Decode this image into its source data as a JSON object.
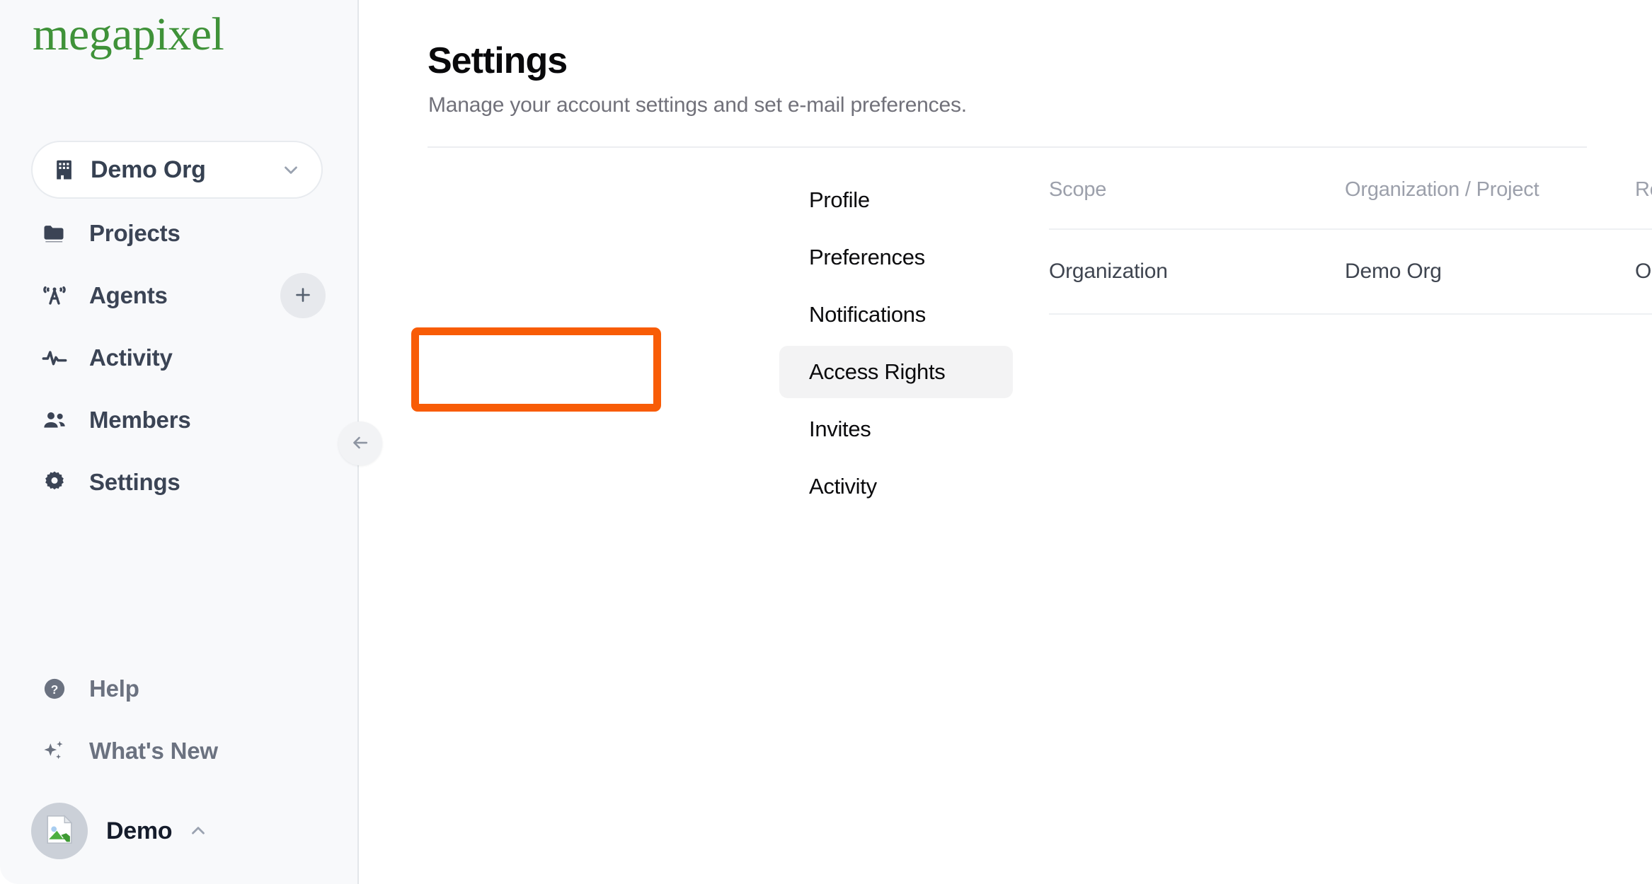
{
  "brand": {
    "logo_text": "megapixel",
    "logo_color": "#3f9239"
  },
  "sidebar": {
    "org_switcher": {
      "label": "Demo Org",
      "icon": "building-icon",
      "chevron": "chevron-down-icon"
    },
    "nav": [
      {
        "id": "projects",
        "label": "Projects",
        "icon": "folder-icon"
      },
      {
        "id": "agents",
        "label": "Agents",
        "icon": "broadcast-tower-icon"
      },
      {
        "id": "activity",
        "label": "Activity",
        "icon": "pulse-icon"
      },
      {
        "id": "members",
        "label": "Members",
        "icon": "people-icon"
      },
      {
        "id": "settings",
        "label": "Settings",
        "icon": "gear-icon"
      }
    ],
    "add_agent": {
      "label": "+",
      "icon": "plus-icon"
    },
    "footer_nav": [
      {
        "id": "help",
        "label": "Help",
        "icon": "question-circle-icon"
      },
      {
        "id": "whats-new",
        "label": "What's New",
        "icon": "sparkles-icon"
      }
    ],
    "user": {
      "name": "Demo",
      "avatar": "broken-image-placeholder-icon",
      "chevron": "chevron-up-icon"
    },
    "collapse": {
      "icon": "arrow-left-icon"
    }
  },
  "main": {
    "title": "Settings",
    "subtitle": "Manage your account settings and set e-mail preferences.",
    "settings_nav": [
      {
        "id": "profile",
        "label": "Profile",
        "active": false
      },
      {
        "id": "preferences",
        "label": "Preferences",
        "active": false
      },
      {
        "id": "notifications",
        "label": "Notifications",
        "active": false
      },
      {
        "id": "access-rights",
        "label": "Access Rights",
        "active": true
      },
      {
        "id": "invites",
        "label": "Invites",
        "active": false
      },
      {
        "id": "activity",
        "label": "Activity",
        "active": false
      }
    ],
    "access_table": {
      "columns": [
        "Scope",
        "Organization / Project",
        "Role"
      ],
      "rows": [
        [
          "Organization",
          "Demo Org",
          "Organization admin (default)"
        ]
      ]
    }
  },
  "annotation": {
    "target": "Access Rights",
    "color": "#f85c06"
  }
}
